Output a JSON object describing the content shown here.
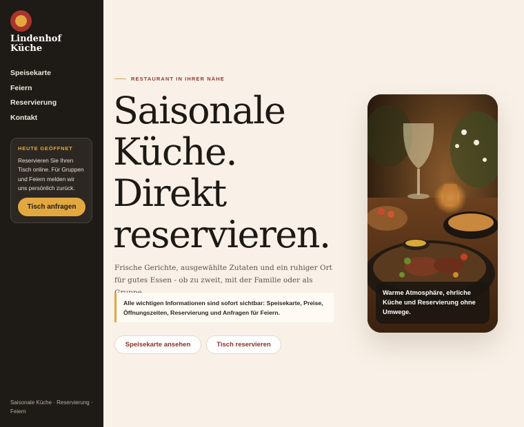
{
  "brand": {
    "line1": "Lindenhof",
    "line2": "Küche",
    "logo_icon": "circle-logo-icon",
    "logo_colors": {
      "outer": "#a8352b",
      "inner": "#e2a83f"
    }
  },
  "nav": {
    "items": [
      {
        "label": "Speisekarte"
      },
      {
        "label": "Feiern"
      },
      {
        "label": "Reservierung"
      },
      {
        "label": "Kontakt"
      }
    ]
  },
  "open_card": {
    "title": "Heute geöffnet",
    "text": "Reservieren Sie Ihren Tisch online. Für Gruppen und Feiern melden wir uns persönlich zurück.",
    "button_label": "Tisch anfragen"
  },
  "sidebar_footer": "Saisonale Küche · Reservierung · Feiern",
  "hero": {
    "eyebrow": "Restaurant in Ihrer Nähe",
    "headline": [
      "Saisonale",
      "Küche.",
      "Direkt",
      "reservieren."
    ],
    "lead": "Frische Gerichte, ausgewählte Zutaten und ein ruhiger Ort für gutes Essen - ob zu zweit, mit der Familie oder als Gruppe.",
    "note": "Alle wichtigen Informationen sind sofort sichtbar: Speisekarte, Preise, Öffnungszeiten, Reservierung und Anfragen für Feiern.",
    "cta_primary": "Speisekarte ansehen",
    "cta_secondary": "Tisch reservieren"
  },
  "photo": {
    "caption": "Warme Atmosphäre, ehrliche Küche und Reservierung ohne Umwege."
  },
  "colors": {
    "background": "#f9f1e8",
    "sidebar": "#1e1a16",
    "accent": "#e2a83f",
    "brand_red": "#8c2e25"
  }
}
